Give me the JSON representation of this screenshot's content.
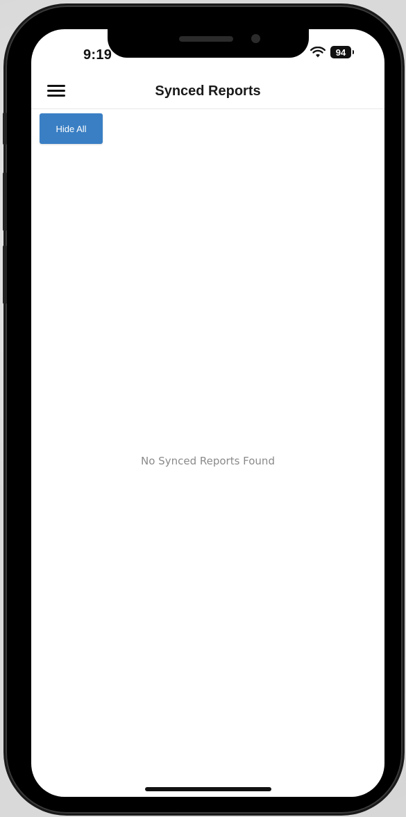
{
  "status_bar": {
    "time": "9:19",
    "battery": "94"
  },
  "header": {
    "title": "Synced Reports",
    "menu_icon": "hamburger-menu-icon"
  },
  "actions": {
    "hide_all_label": "Hide All"
  },
  "main": {
    "empty_message": "No Synced Reports Found"
  },
  "colors": {
    "accent": "#3a7fc4"
  }
}
